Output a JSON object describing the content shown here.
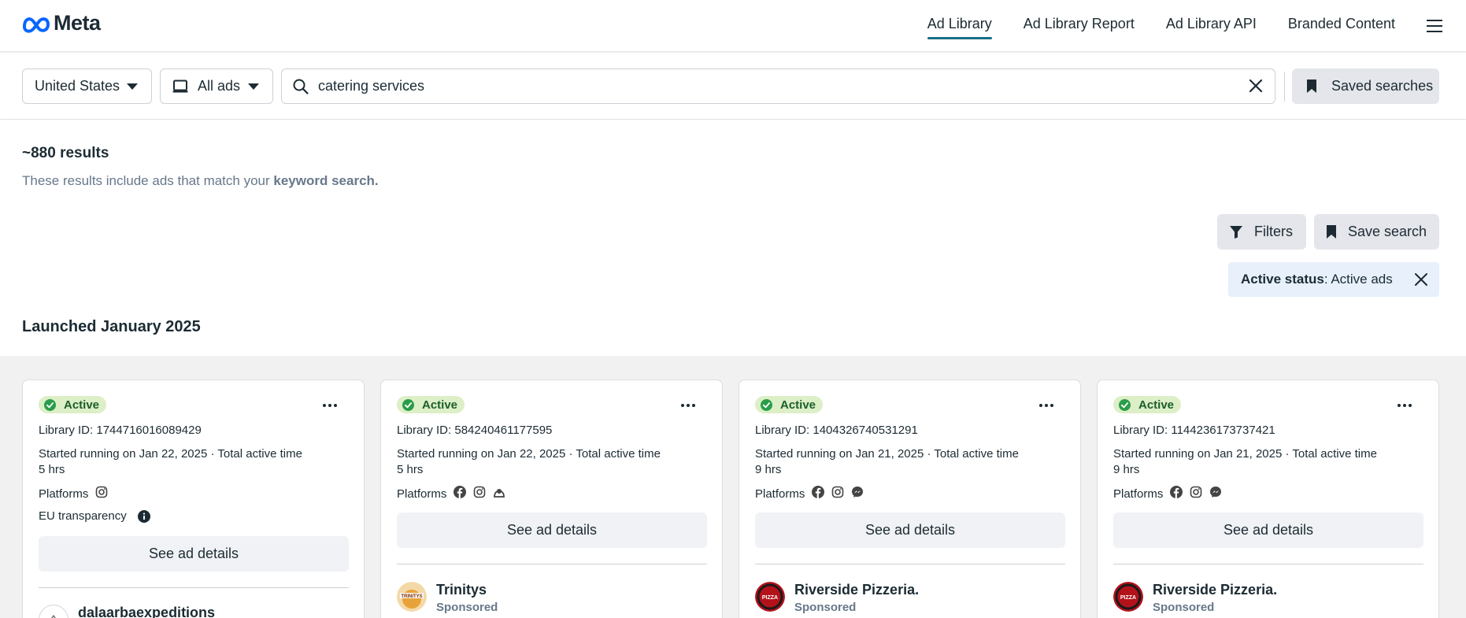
{
  "brand": {
    "logo_text": "Meta",
    "logo_icon": "meta-infinity-icon",
    "color": "#0866ff"
  },
  "nav": {
    "links": [
      "Ad Library",
      "Ad Library Report",
      "Ad Library API",
      "Branded Content"
    ],
    "active": "Ad Library",
    "menu_icon": "hamburger-icon"
  },
  "search": {
    "country": "United States",
    "ad_type": "All ads",
    "query": "catering services",
    "saved_searches_label": "Saved searches"
  },
  "results": {
    "count": "~880 results",
    "description_prefix": "These results include ads that match your ",
    "description_bold": "keyword search.",
    "filters_label": "Filters",
    "save_search_label": "Save search",
    "active_filter": {
      "key": "Active status",
      "value": ": Active ads"
    },
    "section_title": "Launched January 2025"
  },
  "labels": {
    "status": "Active",
    "platforms": "Platforms",
    "see_details": "See ad details",
    "eu_transparency": "EU transparency",
    "sponsored": "Sponsored",
    "total_active": "Total active time"
  },
  "cards": [
    {
      "library_id": "Library ID: 1744716016089429",
      "started": "Started running on Jan 22, 2025 · Total active time",
      "duration": "5 hrs",
      "platforms": [
        "instagram"
      ],
      "eu_transparency": true,
      "advertiser": "dalaarbaexpeditions",
      "sponsored": ""
    },
    {
      "library_id": "Library ID: 584240461177595",
      "started": "Started running on Jan 22, 2025 · Total active time",
      "duration": "5 hrs",
      "platforms": [
        "facebook",
        "instagram",
        "audience-network"
      ],
      "eu_transparency": false,
      "advertiser": "Trinitys",
      "sponsored": "Sponsored"
    },
    {
      "library_id": "Library ID: 1404326740531291",
      "started": "Started running on Jan 21, 2025 · Total active time",
      "duration": "9 hrs",
      "platforms": [
        "facebook",
        "instagram",
        "messenger"
      ],
      "eu_transparency": false,
      "advertiser": "Riverside Pizzeria.",
      "sponsored": "Sponsored"
    },
    {
      "library_id": "Library ID: 1144236173737421",
      "started": "Started running on Jan 21, 2025 · Total active time",
      "duration": "9 hrs",
      "platforms": [
        "facebook",
        "instagram",
        "messenger"
      ],
      "eu_transparency": false,
      "advertiser": "Riverside Pizzeria.",
      "sponsored": "Sponsored"
    }
  ],
  "colors": {
    "active_bg": "#dcefc7",
    "active_text": "#1c5d2c",
    "accent_underline": "#1a6e88",
    "chip_bg": "#e7f0fb"
  }
}
